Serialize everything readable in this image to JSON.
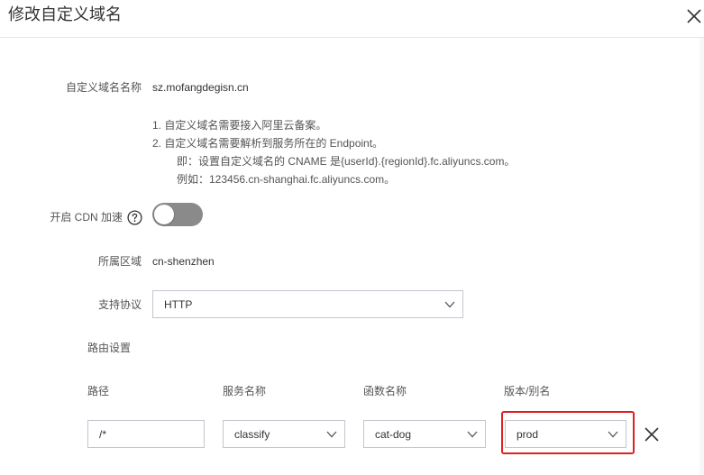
{
  "dialog": {
    "title": "修改自定义域名"
  },
  "form": {
    "domain_name": {
      "label": "自定义域名名称",
      "value": "sz.mofangdegisn.cn"
    },
    "notes": [
      "1. 自定义域名需要接入阿里云备案。",
      "2. 自定义域名需要解析到服务所在的 Endpoint。",
      "即：设置自定义域名的 CNAME 是{userId}.{regionId}.fc.aliyuncs.com。",
      "例如：123456.cn-shanghai.fc.aliyuncs.com。"
    ],
    "cdn": {
      "label": "开启 CDN 加速",
      "enabled": false
    },
    "region": {
      "label": "所属区域",
      "value": "cn-shenzhen"
    },
    "protocol": {
      "label": "支持协议",
      "value": "HTTP"
    },
    "routing": {
      "label": "路由设置",
      "columns": [
        "路径",
        "服务名称",
        "函数名称",
        "版本/别名"
      ],
      "row": {
        "path": "/*",
        "service": "classify",
        "function": "cat-dog",
        "version": "prod"
      }
    }
  },
  "icons": {
    "close": "close-icon",
    "help": "question-circle-icon",
    "chevron": "chevron-down-icon",
    "remove": "close-icon"
  },
  "colors": {
    "highlight": "#e02020",
    "switch_off": "#8a8a8a",
    "border": "#c4c6cf"
  }
}
